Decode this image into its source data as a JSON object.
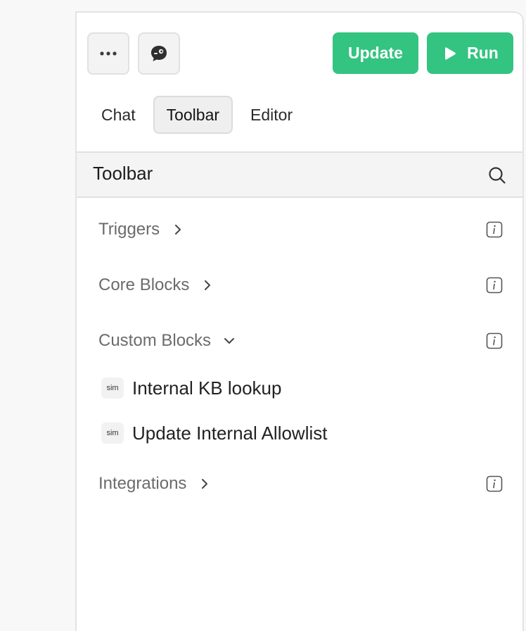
{
  "toolbar": {
    "update_label": "Update",
    "run_label": "Run",
    "accent_color": "#33c481"
  },
  "tabs": [
    {
      "label": "Chat",
      "active": false
    },
    {
      "label": "Toolbar",
      "active": true
    },
    {
      "label": "Editor",
      "active": false
    }
  ],
  "section": {
    "title": "Toolbar"
  },
  "categories": [
    {
      "label": "Triggers",
      "expanded": false
    },
    {
      "label": "Core Blocks",
      "expanded": false
    },
    {
      "label": "Custom Blocks",
      "expanded": true
    },
    {
      "label": "Integrations",
      "expanded": false
    }
  ],
  "custom_blocks": [
    {
      "badge": "sim",
      "label": "Internal KB lookup"
    },
    {
      "badge": "sim",
      "label": "Update Internal Allowlist"
    }
  ],
  "icons": {
    "more": "more-horizontal-icon",
    "copilot": "copilot-icon",
    "run": "play-icon",
    "search": "search-icon",
    "info": "info-icon",
    "chevron_right": "chevron-right-icon",
    "chevron_down": "chevron-down-icon"
  }
}
